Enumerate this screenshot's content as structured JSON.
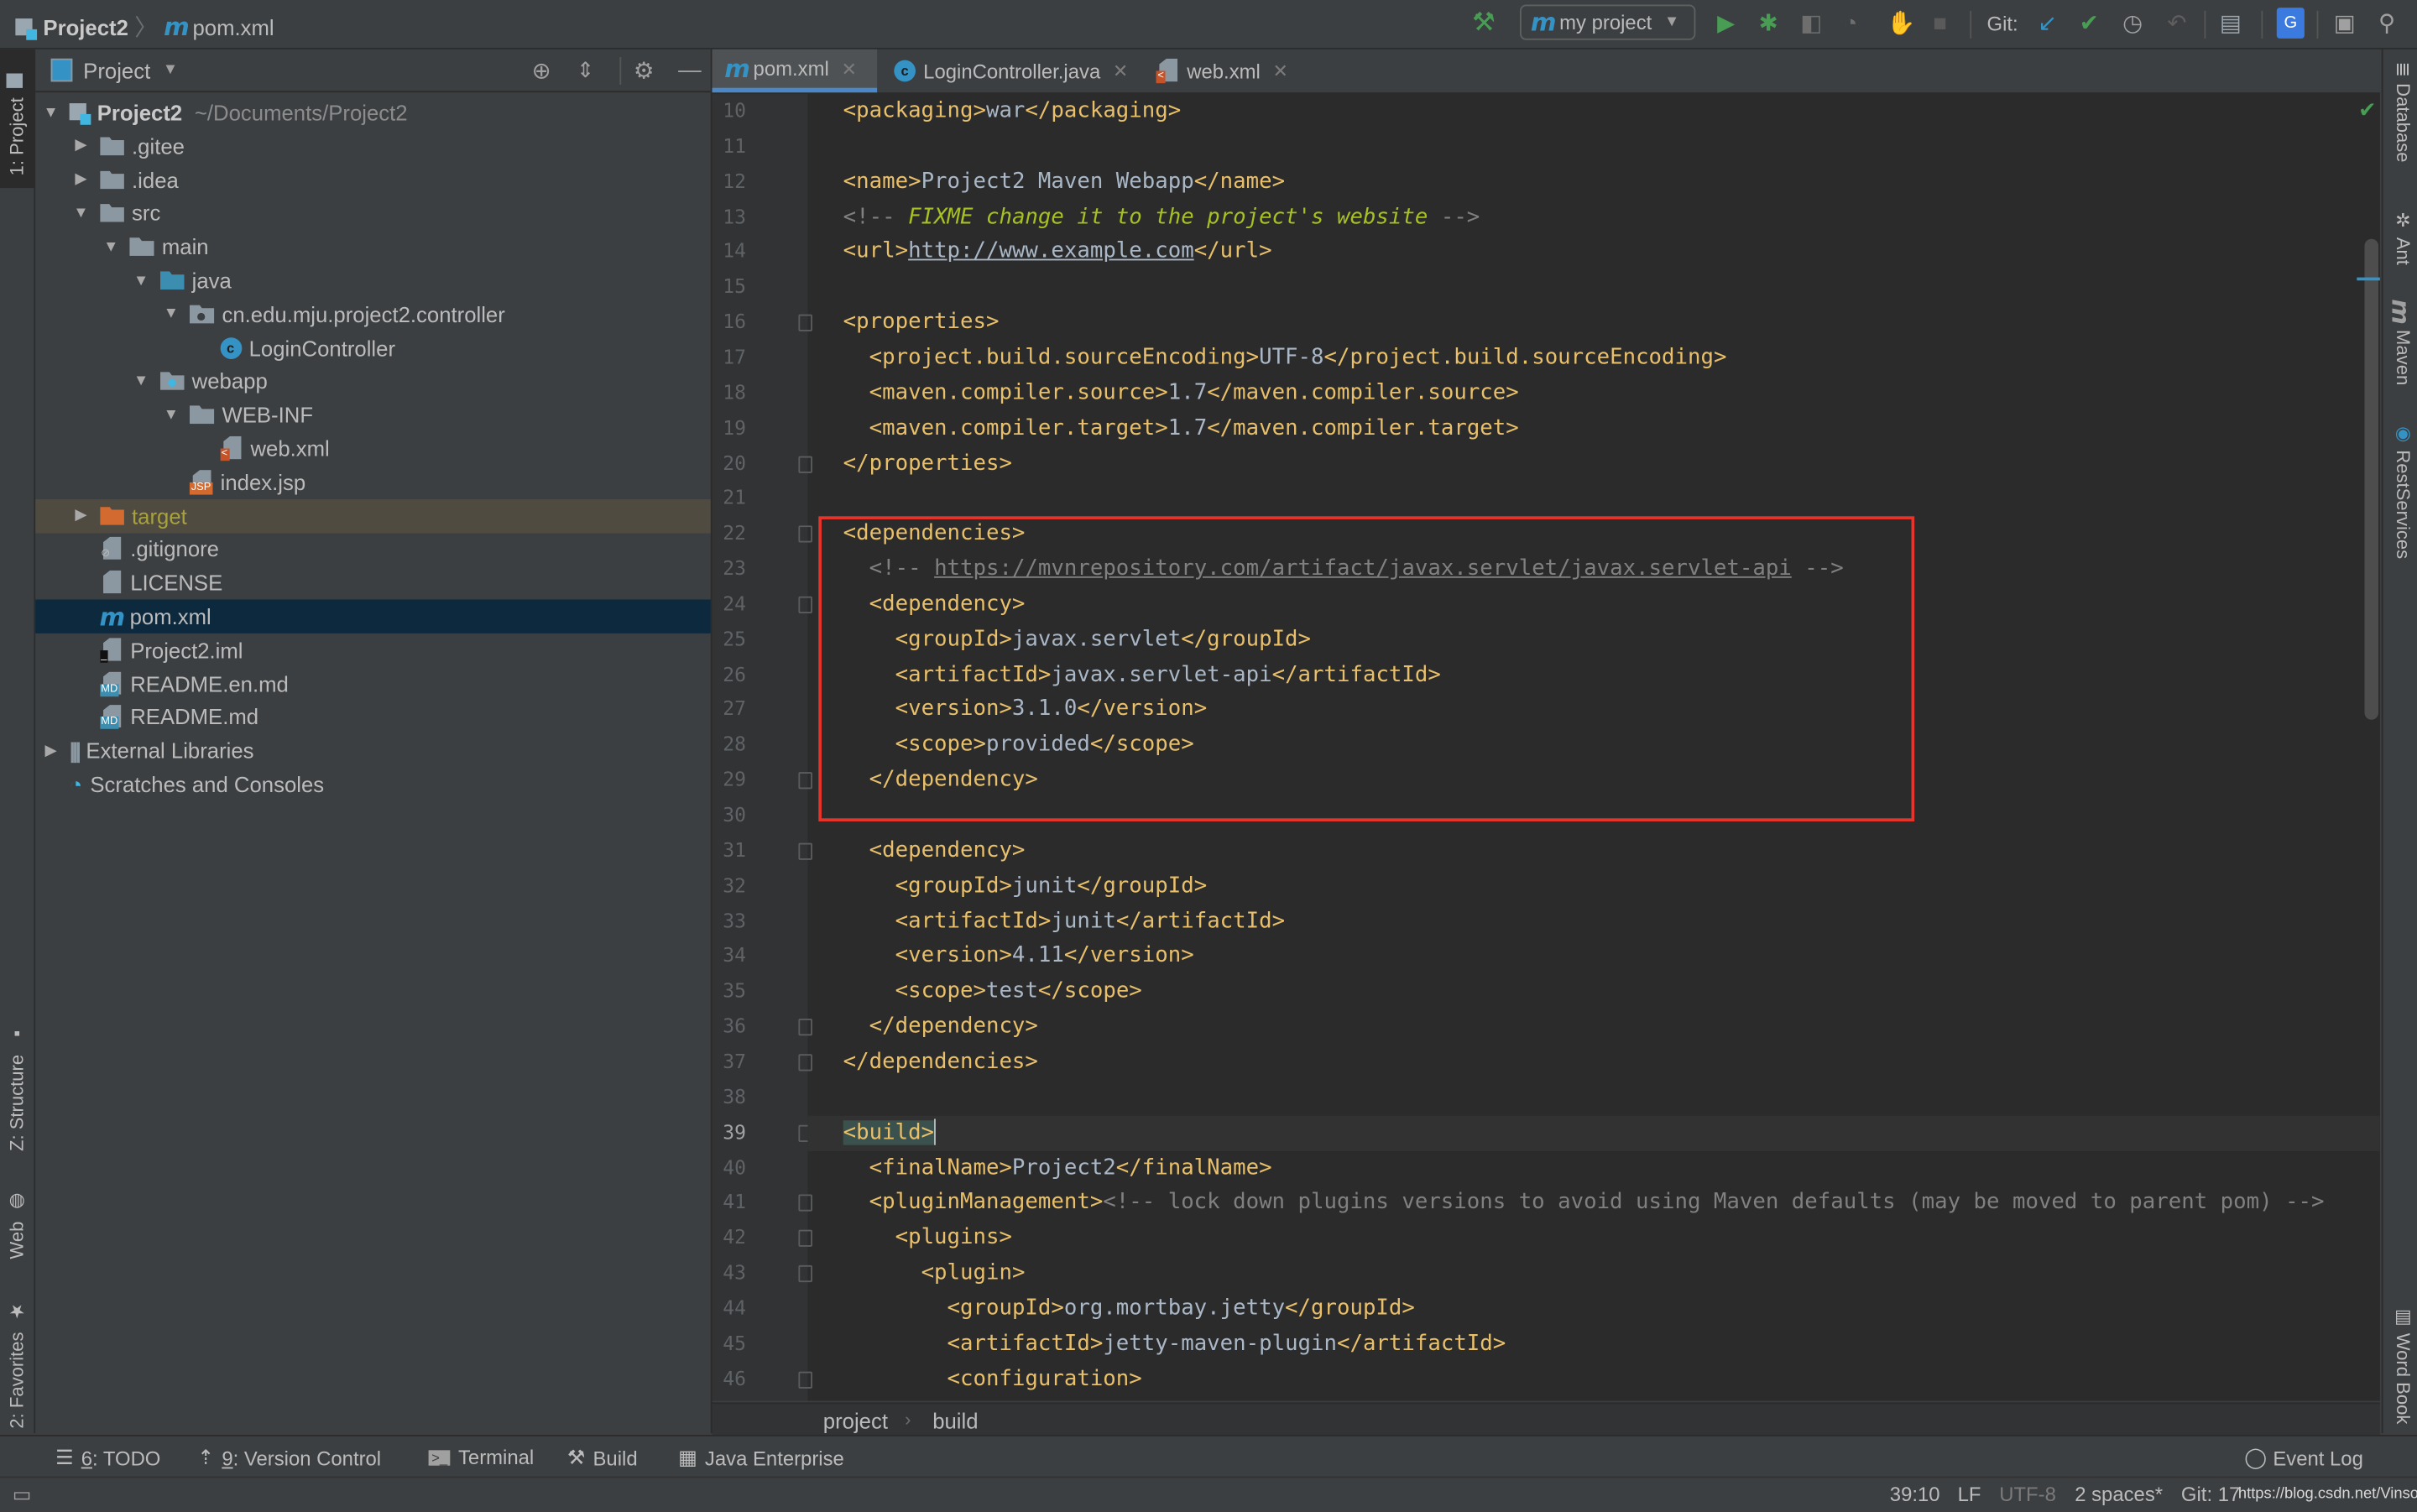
{
  "navbar": {
    "breadcrumb": [
      "Project2",
      "pom.xml"
    ],
    "run_config": "my project",
    "git_label": "Git:"
  },
  "left_strip": {
    "tabs": [
      "1: Project",
      "Z: Structure",
      "Web",
      "2: Favorites"
    ]
  },
  "right_strip": {
    "tabs": [
      "Database",
      "Ant",
      "Maven",
      "RestServices",
      "Word Book"
    ]
  },
  "project_panel": {
    "title": "Project",
    "tree": [
      {
        "label": "Project2",
        "extra": "~/Documents/Project2",
        "depth": 0,
        "arrow": "open",
        "icon": "project"
      },
      {
        "label": ".gitee",
        "depth": 1,
        "arrow": "closed",
        "icon": "folder"
      },
      {
        "label": ".idea",
        "depth": 1,
        "arrow": "closed",
        "icon": "folder"
      },
      {
        "label": "src",
        "depth": 1,
        "arrow": "open",
        "icon": "folder"
      },
      {
        "label": "main",
        "depth": 2,
        "arrow": "open",
        "icon": "folder"
      },
      {
        "label": "java",
        "depth": 3,
        "arrow": "open",
        "icon": "source-folder"
      },
      {
        "label": "cn.edu.mju.project2.controller",
        "depth": 4,
        "arrow": "open",
        "icon": "package"
      },
      {
        "label": "LoginController",
        "depth": 5,
        "arrow": "none",
        "icon": "class"
      },
      {
        "label": "webapp",
        "depth": 3,
        "arrow": "open",
        "icon": "web-folder"
      },
      {
        "label": "WEB-INF",
        "depth": 4,
        "arrow": "open",
        "icon": "folder"
      },
      {
        "label": "web.xml",
        "depth": 5,
        "arrow": "none",
        "icon": "web-xml"
      },
      {
        "label": "index.jsp",
        "depth": 4,
        "arrow": "none",
        "icon": "jsp"
      },
      {
        "label": "target",
        "depth": 1,
        "arrow": "closed",
        "icon": "excluded-folder",
        "state": "excluded"
      },
      {
        "label": ".gitignore",
        "depth": 1,
        "arrow": "none",
        "icon": "ignore-file"
      },
      {
        "label": "LICENSE",
        "depth": 1,
        "arrow": "none",
        "icon": "text-file"
      },
      {
        "label": "pom.xml",
        "depth": 1,
        "arrow": "none",
        "icon": "maven",
        "state": "selected"
      },
      {
        "label": "Project2.iml",
        "depth": 1,
        "arrow": "none",
        "icon": "iml-file"
      },
      {
        "label": "README.en.md",
        "depth": 1,
        "arrow": "none",
        "icon": "markdown"
      },
      {
        "label": "README.md",
        "depth": 1,
        "arrow": "none",
        "icon": "markdown"
      },
      {
        "label": "External Libraries",
        "depth": 0,
        "arrow": "closed",
        "icon": "libraries"
      },
      {
        "label": "Scratches and Consoles",
        "depth": 0,
        "arrow": "none",
        "icon": "scratches"
      }
    ]
  },
  "editor": {
    "tabs": [
      {
        "label": "pom.xml",
        "icon": "maven",
        "active": true
      },
      {
        "label": "LoginController.java",
        "icon": "class",
        "active": false
      },
      {
        "label": "web.xml",
        "icon": "web-xml",
        "active": false
      }
    ],
    "caret_line": 39,
    "lines": [
      {
        "n": "10",
        "indent": 0,
        "parts": [
          [
            "tag",
            "<packaging>"
          ],
          [
            "txt",
            "war"
          ],
          [
            "tag",
            "</packaging>"
          ]
        ]
      },
      {
        "n": "11",
        "indent": 0,
        "parts": []
      },
      {
        "n": "12",
        "indent": 0,
        "parts": [
          [
            "tag",
            "<name>"
          ],
          [
            "txt",
            "Project2 Maven Webapp"
          ],
          [
            "tag",
            "</name>"
          ]
        ]
      },
      {
        "n": "13",
        "indent": 0,
        "parts": [
          [
            "cmt",
            "<!-- "
          ],
          [
            "todo",
            "FIXME change it to the project's website"
          ],
          [
            "cmt",
            " -->"
          ]
        ]
      },
      {
        "n": "14",
        "indent": 0,
        "parts": [
          [
            "tag",
            "<url>"
          ],
          [
            "url",
            "http://www.example.com"
          ],
          [
            "tag",
            "</url>"
          ]
        ]
      },
      {
        "n": "15",
        "indent": 0,
        "parts": []
      },
      {
        "n": "16",
        "indent": 0,
        "fold": true,
        "parts": [
          [
            "tag",
            "<properties>"
          ]
        ]
      },
      {
        "n": "17",
        "indent": 1,
        "parts": [
          [
            "tag",
            "<project.build.sourceEncoding>"
          ],
          [
            "txt",
            "UTF-8"
          ],
          [
            "tag",
            "</project.build.sourceEncoding>"
          ]
        ]
      },
      {
        "n": "18",
        "indent": 1,
        "parts": [
          [
            "tag",
            "<maven.compiler.source>"
          ],
          [
            "txt",
            "1.7"
          ],
          [
            "tag",
            "</maven.compiler.source>"
          ]
        ]
      },
      {
        "n": "19",
        "indent": 1,
        "parts": [
          [
            "tag",
            "<maven.compiler.target>"
          ],
          [
            "txt",
            "1.7"
          ],
          [
            "tag",
            "</maven.compiler.target>"
          ]
        ]
      },
      {
        "n": "20",
        "indent": 0,
        "fold": true,
        "parts": [
          [
            "tag",
            "</properties>"
          ]
        ]
      },
      {
        "n": "21",
        "indent": 0,
        "parts": []
      },
      {
        "n": "22",
        "indent": 0,
        "fold": true,
        "parts": [
          [
            "tag",
            "<dependencies>"
          ]
        ]
      },
      {
        "n": "23",
        "indent": 1,
        "parts": [
          [
            "cmt",
            "<!-- "
          ],
          [
            "curl",
            "https://mvnrepository.com/artifact/javax.servlet/javax.servlet-api"
          ],
          [
            "cmt",
            " -->"
          ]
        ]
      },
      {
        "n": "24",
        "indent": 1,
        "fold": true,
        "parts": [
          [
            "tag",
            "<dependency>"
          ]
        ]
      },
      {
        "n": "25",
        "indent": 2,
        "parts": [
          [
            "tag",
            "<groupId>"
          ],
          [
            "txt",
            "javax.servlet"
          ],
          [
            "tag",
            "</groupId>"
          ]
        ]
      },
      {
        "n": "26",
        "indent": 2,
        "parts": [
          [
            "tag",
            "<artifactId>"
          ],
          [
            "txt",
            "javax.servlet-api"
          ],
          [
            "tag",
            "</artifactId>"
          ]
        ]
      },
      {
        "n": "27",
        "indent": 2,
        "parts": [
          [
            "tag",
            "<version>"
          ],
          [
            "txt",
            "3.1.0"
          ],
          [
            "tag",
            "</version>"
          ]
        ]
      },
      {
        "n": "28",
        "indent": 2,
        "parts": [
          [
            "tag",
            "<scope>"
          ],
          [
            "txt",
            "provided"
          ],
          [
            "tag",
            "</scope>"
          ]
        ]
      },
      {
        "n": "29",
        "indent": 1,
        "fold": true,
        "parts": [
          [
            "tag",
            "</dependency>"
          ]
        ]
      },
      {
        "n": "30",
        "indent": 0,
        "parts": []
      },
      {
        "n": "31",
        "indent": 1,
        "fold": true,
        "parts": [
          [
            "tag",
            "<dependency>"
          ]
        ]
      },
      {
        "n": "32",
        "indent": 2,
        "parts": [
          [
            "tag",
            "<groupId>"
          ],
          [
            "txt",
            "junit"
          ],
          [
            "tag",
            "</groupId>"
          ]
        ]
      },
      {
        "n": "33",
        "indent": 2,
        "parts": [
          [
            "tag",
            "<artifactId>"
          ],
          [
            "txt",
            "junit"
          ],
          [
            "tag",
            "</artifactId>"
          ]
        ]
      },
      {
        "n": "34",
        "indent": 2,
        "parts": [
          [
            "tag",
            "<version>"
          ],
          [
            "txt",
            "4.11"
          ],
          [
            "tag",
            "</version>"
          ]
        ]
      },
      {
        "n": "35",
        "indent": 2,
        "parts": [
          [
            "tag",
            "<scope>"
          ],
          [
            "txt",
            "test"
          ],
          [
            "tag",
            "</scope>"
          ]
        ]
      },
      {
        "n": "36",
        "indent": 1,
        "fold": true,
        "parts": [
          [
            "tag",
            "</dependency>"
          ]
        ]
      },
      {
        "n": "37",
        "indent": 0,
        "fold": true,
        "parts": [
          [
            "tag",
            "</dependencies>"
          ]
        ]
      },
      {
        "n": "38",
        "indent": 0,
        "parts": []
      },
      {
        "n": "39",
        "indent": 0,
        "fold": true,
        "parts": [
          [
            "matched",
            "<build>"
          ]
        ]
      },
      {
        "n": "40",
        "indent": 1,
        "parts": [
          [
            "tag",
            "<finalName>"
          ],
          [
            "txt",
            "Project2"
          ],
          [
            "tag",
            "</finalName>"
          ]
        ]
      },
      {
        "n": "41",
        "indent": 1,
        "fold": true,
        "parts": [
          [
            "tag",
            "<pluginManagement>"
          ],
          [
            "cmt",
            "<!-- lock down plugins versions to avoid using Maven defaults (may be moved to parent pom) -->"
          ]
        ]
      },
      {
        "n": "42",
        "indent": 2,
        "fold": true,
        "parts": [
          [
            "tag",
            "<plugins>"
          ]
        ]
      },
      {
        "n": "43",
        "indent": 3,
        "fold": true,
        "parts": [
          [
            "tag",
            "<plugin>"
          ]
        ]
      },
      {
        "n": "44",
        "indent": 4,
        "parts": [
          [
            "tag",
            "<groupId>"
          ],
          [
            "txt",
            "org.mortbay.jetty"
          ],
          [
            "tag",
            "</groupId>"
          ]
        ]
      },
      {
        "n": "45",
        "indent": 4,
        "parts": [
          [
            "tag",
            "<artifactId>"
          ],
          [
            "txt",
            "jetty-maven-plugin"
          ],
          [
            "tag",
            "</artifactId>"
          ]
        ]
      },
      {
        "n": "46",
        "indent": 4,
        "fold": true,
        "parts": [
          [
            "tag",
            "<configuration>"
          ]
        ]
      }
    ],
    "breadcrumb": [
      "project",
      "build"
    ]
  },
  "bottom_tools": [
    {
      "key": "6",
      "label": ": TODO",
      "icon": "todo-list-icon"
    },
    {
      "key": "9",
      "label": ": Version Control",
      "icon": "version-control-icon"
    },
    {
      "key": "",
      "label": "Terminal",
      "icon": "terminal-icon"
    },
    {
      "key": "",
      "label": "Build",
      "icon": "hammer-icon"
    },
    {
      "key": "",
      "label": "Java Enterprise",
      "icon": "java-enterprise-icon"
    }
  ],
  "event_log": "Event Log",
  "status": {
    "position": "39:10",
    "line_sep": "LF",
    "encoding": "UTF-8",
    "indent": "2 spaces*",
    "git": "Git: 17",
    "watermark": "https://blog.csdn.net/Vinsony"
  },
  "colors": {
    "accent": "#4a88c7",
    "highlight_box": "#e5342b",
    "tag": "#e8bf6a",
    "text": "#a9b7c6",
    "comment": "#808080",
    "todo": "#a8c023",
    "run_green": "#499c54"
  }
}
